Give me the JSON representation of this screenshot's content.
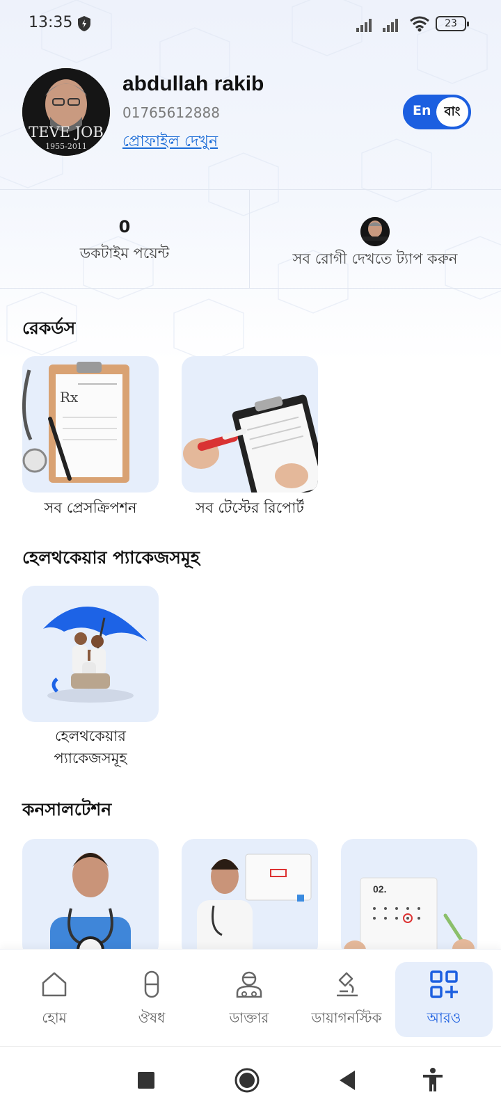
{
  "status_bar": {
    "time": "13:35",
    "battery": "23"
  },
  "profile": {
    "name": "abdullah rakib",
    "phone": "01765612888",
    "view_profile_link": "প্রোফাইল দেখুন",
    "avatar_caption_top": "TEVE JOB",
    "avatar_caption_bottom": "1955-2011"
  },
  "language_toggle": {
    "en": "En",
    "bn": "বাং",
    "selected": "bn"
  },
  "stats": {
    "points_value": "0",
    "points_label": "ডকটাইম পয়েন্ট",
    "patients_label": "সব রোগী দেখতে ট্যাপ করুন"
  },
  "sections": {
    "records": {
      "title": "রেকর্ডস",
      "items": [
        {
          "label": "সব প্রেসক্রিপশন"
        },
        {
          "label": "সব টেস্টের রিপোর্ট"
        }
      ]
    },
    "packages": {
      "title": "হেলথকেয়ার প্যাকেজসমূহ",
      "items": [
        {
          "label_line1": "হেলথকেয়ার",
          "label_line2": "প্যাকেজসমূহ"
        }
      ]
    },
    "consultation": {
      "title": "কনসালটেশন",
      "calendar_text": "02."
    }
  },
  "bottom_nav": {
    "items": [
      {
        "label": "হোম",
        "icon": "home-icon"
      },
      {
        "label": "ঔষধ",
        "icon": "pill-icon"
      },
      {
        "label": "ডাক্তার",
        "icon": "doctor-icon"
      },
      {
        "label": "ডায়াগনস্টিক",
        "icon": "microscope-icon"
      },
      {
        "label": "আরও",
        "icon": "grid-plus-icon",
        "active": true
      }
    ]
  },
  "colors": {
    "accent": "#1c5fe0",
    "card_bg": "#e6eefb",
    "link": "#1a6bd6"
  }
}
